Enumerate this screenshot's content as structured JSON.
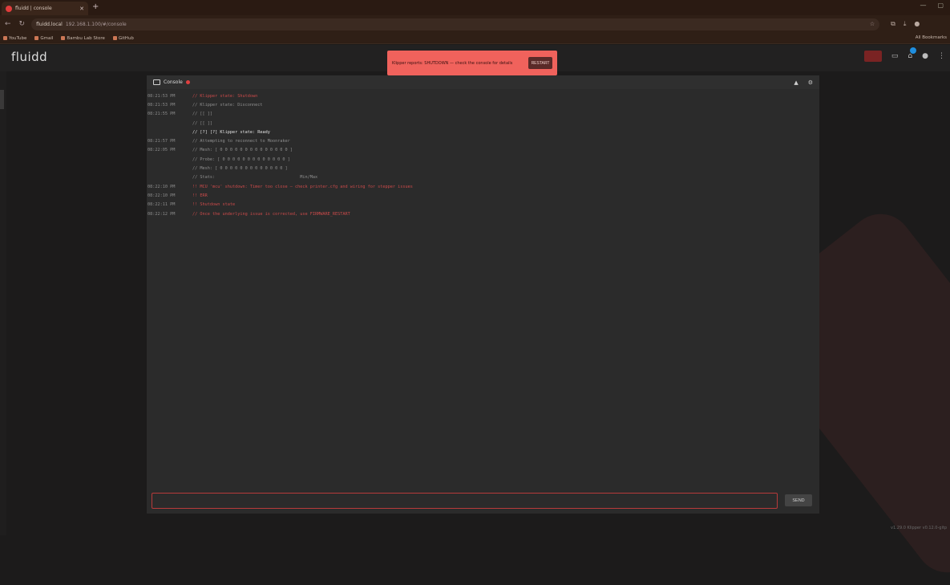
{
  "browser": {
    "tab_title": "fluidd | console",
    "url_site": "fluidd.local",
    "url_path": "192.168.1.100/#/console",
    "bookmarks": [
      "YouTube",
      "Gmail",
      "Bambu Lab Store",
      "GitHub"
    ],
    "bookmarks_all": "All Bookmarks"
  },
  "app": {
    "brand": "fluidd",
    "footer": "v1.29.0  Klipper v0.12.0-gitp"
  },
  "toast": {
    "message": "Klipper reports: SHUTDOWN — check the console for details",
    "button": "RESTART"
  },
  "console": {
    "title": "Console",
    "send_label": "SEND",
    "input_placeholder": "",
    "lines": [
      {
        "time": "08:21:53 PM",
        "text": "// Klipper state: Shutdown",
        "style": "err"
      },
      {
        "time": "08:21:53 PM",
        "text": "// Klipper state: Disconnect",
        "style": "dim"
      },
      {
        "time": "08:21:55 PM",
        "text": "// [[ ]]",
        "style": "dim"
      },
      {
        "time": "",
        "text": "// [[ ]]",
        "style": "dim"
      },
      {
        "time": "",
        "text": "// [?] [?] Klipper state: Ready",
        "style": "bright"
      },
      {
        "time": "08:21:57 PM",
        "text": "// Attempting to reconnect to Moonraker",
        "style": "dim"
      },
      {
        "time": "08:22:05 PM",
        "text": "// Mesh: [ 0 0 0 0 0 0 0 0 0 0 0 0 0 0 ]",
        "style": "dim"
      },
      {
        "time": "",
        "text": "// Probe: [ 0 0 0 0 0 0 0 0 0 0 0 0 0 ]",
        "style": "dim"
      },
      {
        "time": "",
        "text": "// Mesh: [ 0 0 0 0 0 0 0 0 0 0 0 0 0 ]",
        "style": "dim"
      },
      {
        "time": "",
        "text": "// Stats:                                  Min/Max",
        "style": "dim"
      },
      {
        "time": "08:22:10 PM",
        "text": "!! MCU 'mcu' shutdown: Timer too close — check printer.cfg and wiring for stepper issues",
        "style": "err"
      },
      {
        "time": "08:22:10 PM",
        "text": "!! ERR",
        "style": "err"
      },
      {
        "time": "08:22:11 PM",
        "text": "!! Shutdown state",
        "style": "err"
      },
      {
        "time": "08:22:12 PM",
        "text": "// Once the underlying issue is corrected, use FIRMWARE_RESTART",
        "style": "err"
      }
    ]
  },
  "colors": {
    "accent": "#f0625c",
    "error": "#c94a4a",
    "panel": "#2b2b2b"
  }
}
